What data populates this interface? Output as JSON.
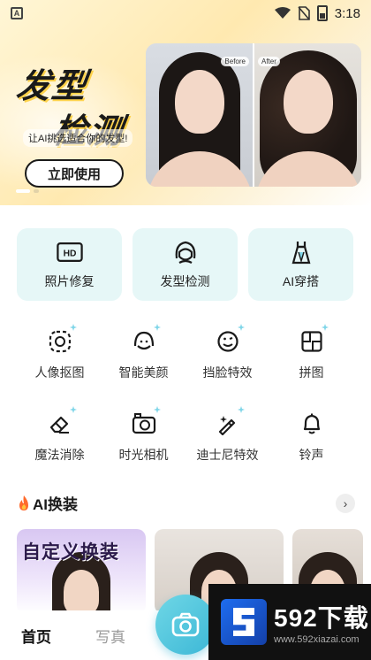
{
  "status_bar": {
    "time": "3:18"
  },
  "banner": {
    "title_line1": "发型",
    "title_line2": "检测",
    "subtitle": "让AI挑选适合你的发型!",
    "cta_label": "立即使用",
    "photo_tag_before": "Before",
    "photo_tag_after": "After"
  },
  "features": [
    {
      "label": "照片修复",
      "icon": "hd-icon"
    },
    {
      "label": "发型检测",
      "icon": "hair-head-icon"
    },
    {
      "label": "AI穿搭",
      "icon": "dress-icon"
    }
  ],
  "tools_row1": [
    {
      "label": "人像抠图",
      "icon": "cutout-icon"
    },
    {
      "label": "智能美颜",
      "icon": "beauty-face-icon"
    },
    {
      "label": "挡脸特效",
      "icon": "sticker-face-icon"
    },
    {
      "label": "拼图",
      "icon": "collage-icon"
    }
  ],
  "tools_row2": [
    {
      "label": "魔法消除",
      "icon": "eraser-icon"
    },
    {
      "label": "时光相机",
      "icon": "time-camera-icon"
    },
    {
      "label": "迪士尼特效",
      "icon": "magic-wand-icon"
    },
    {
      "label": "铃声",
      "icon": "bell-icon"
    }
  ],
  "ai_section": {
    "title": "AI换装",
    "more_icon": "chevron-right-icon",
    "cards": [
      {
        "title": "自定义换装"
      }
    ]
  },
  "bottom_nav": {
    "home": "首页",
    "photo": "写真"
  },
  "watermark": {
    "big": "592下载",
    "small": "www.592xiazai.com"
  },
  "colors": {
    "feature_card_bg": "#e6f7f7",
    "fab_accent": "#3cb7d6",
    "sparkle": "#7fd6e8"
  }
}
